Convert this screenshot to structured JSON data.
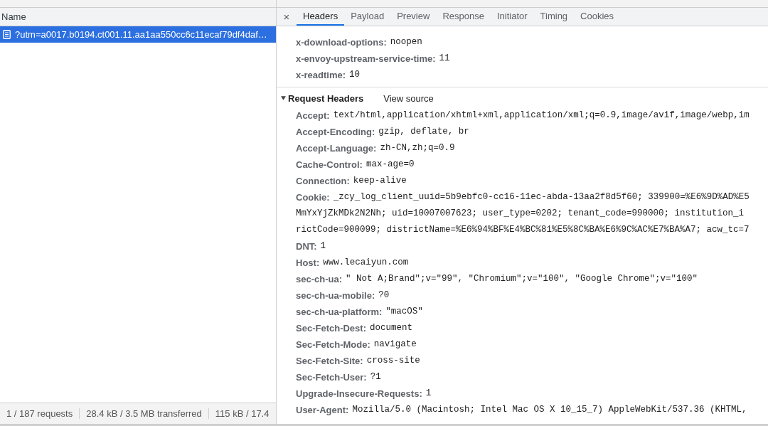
{
  "requests": {
    "column_header": "Name",
    "rows": [
      {
        "name": "?utm=a0017.b0194.ct001.11.aa1aa550cc6c11ecaf79df4daf…",
        "selected": true
      }
    ]
  },
  "status_bar": [
    "1 / 187 requests",
    "28.4 kB / 3.5 MB transferred",
    "115 kB / 17.4"
  ],
  "detail": {
    "close": "×",
    "tabs": [
      {
        "label": "Headers",
        "selected": true
      },
      {
        "label": "Payload",
        "selected": false
      },
      {
        "label": "Preview",
        "selected": false
      },
      {
        "label": "Response",
        "selected": false
      },
      {
        "label": "Initiator",
        "selected": false
      },
      {
        "label": "Timing",
        "selected": false
      },
      {
        "label": "Cookies",
        "selected": false
      }
    ],
    "response_headers": [
      {
        "name": "x-download-options:",
        "value": "noopen"
      },
      {
        "name": "x-envoy-upstream-service-time:",
        "value": "11"
      },
      {
        "name": "x-readtime:",
        "value": "10"
      }
    ],
    "request_section": {
      "title": "Request Headers",
      "expanded": true,
      "view_source": "View source"
    },
    "request_headers": [
      {
        "name": "Accept:",
        "lines": [
          "text/html,application/xhtml+xml,application/xml;q=0.9,image/avif,image/webp,im"
        ]
      },
      {
        "name": "Accept-Encoding:",
        "lines": [
          "gzip, deflate, br"
        ]
      },
      {
        "name": "Accept-Language:",
        "lines": [
          "zh-CN,zh;q=0.9"
        ]
      },
      {
        "name": "Cache-Control:",
        "lines": [
          "max-age=0"
        ]
      },
      {
        "name": "Connection:",
        "lines": [
          "keep-alive"
        ]
      },
      {
        "name": "Cookie:",
        "lines": [
          "_zcy_log_client_uuid=5b9ebfc0-cc16-11ec-abda-13aa2f8d5f60; 339900=%E6%9D%AD%E5",
          "MmYxYjZkMDk2N2Nh; uid=10007007623; user_type=0202; tenant_code=990000; institution_i",
          "rictCode=900099; districtName=%E6%94%BF%E4%BC%81%E5%8C%BA%E6%9C%AC%E7%BA%A7; acw_tc=7"
        ]
      },
      {
        "name": "DNT:",
        "lines": [
          "1"
        ]
      },
      {
        "name": "Host:",
        "lines": [
          "www.lecaiyun.com"
        ]
      },
      {
        "name": "sec-ch-ua:",
        "lines": [
          "\" Not A;Brand\";v=\"99\", \"Chromium\";v=\"100\", \"Google Chrome\";v=\"100\""
        ]
      },
      {
        "name": "sec-ch-ua-mobile:",
        "lines": [
          "?0"
        ]
      },
      {
        "name": "sec-ch-ua-platform:",
        "lines": [
          "\"macOS\""
        ]
      },
      {
        "name": "Sec-Fetch-Dest:",
        "lines": [
          "document"
        ]
      },
      {
        "name": "Sec-Fetch-Mode:",
        "lines": [
          "navigate"
        ]
      },
      {
        "name": "Sec-Fetch-Site:",
        "lines": [
          "cross-site"
        ]
      },
      {
        "name": "Sec-Fetch-User:",
        "lines": [
          "?1"
        ]
      },
      {
        "name": "Upgrade-Insecure-Requests:",
        "lines": [
          "1"
        ]
      },
      {
        "name": "User-Agent:",
        "lines": [
          "Mozilla/5.0 (Macintosh; Intel Mac OS X 10_15_7) AppleWebKit/537.36 (KHTML,"
        ]
      }
    ]
  }
}
